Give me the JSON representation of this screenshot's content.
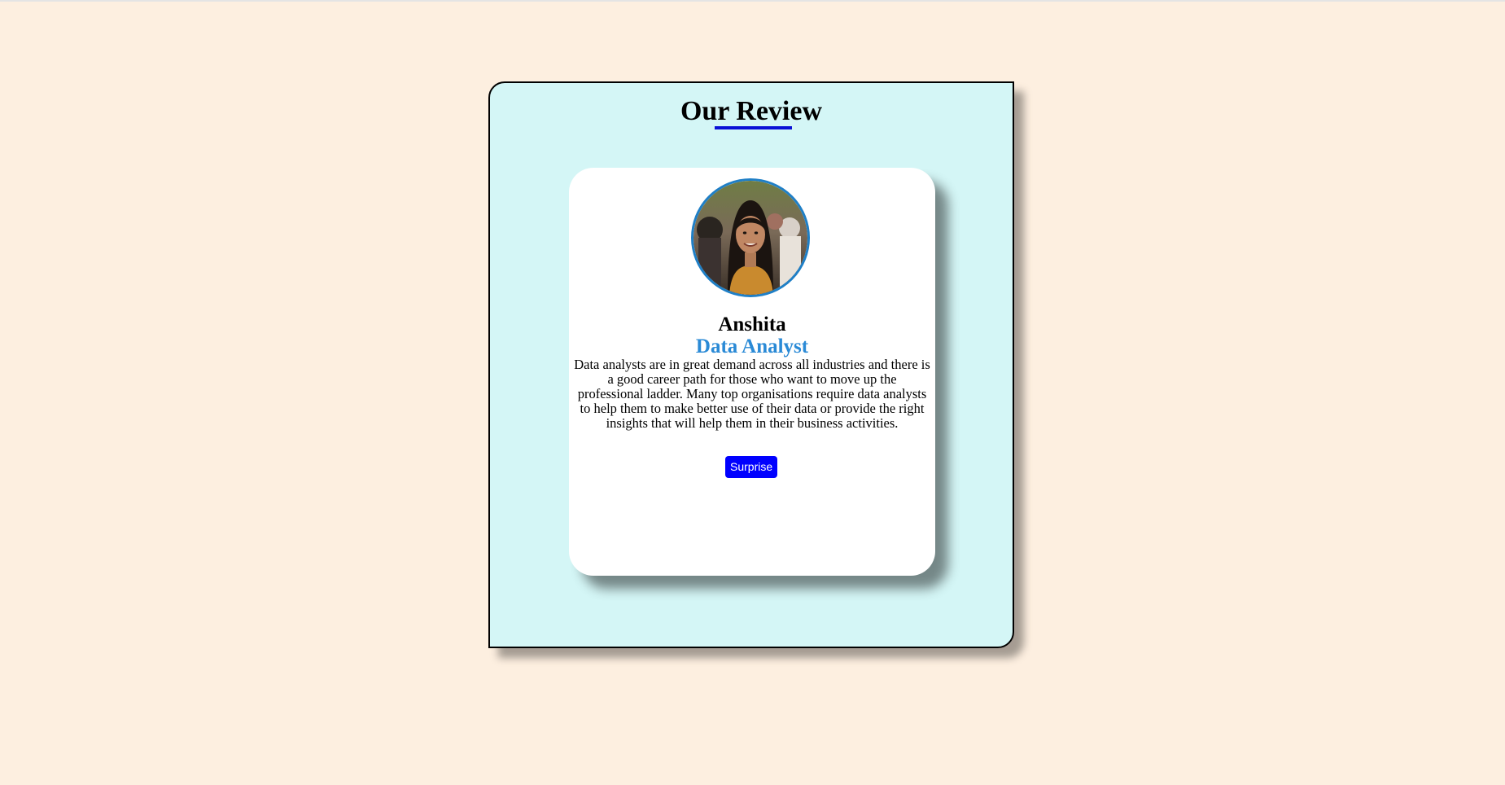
{
  "review": {
    "title": "Our Review",
    "person": {
      "name": "Anshita",
      "role": "Data Analyst",
      "text": "Data analysts are in great demand across all industries and there is a good career path for those who want to move up the professional ladder. Many top organisations require data analysts to help them to make better use of their data or provide the right insights that will help them in their business activities.",
      "photo_icon": "person-photo"
    },
    "button_label": "Surprise"
  },
  "colors": {
    "page_background": "#fdefe0",
    "panel_background": "#d4f6f6",
    "card_background": "#ffffff",
    "title_underline": "#0b11d6",
    "role_text": "#2a8ad6",
    "avatar_border": "#1f7fc6",
    "button_background": "#0000ff",
    "button_text": "#ffffff"
  }
}
